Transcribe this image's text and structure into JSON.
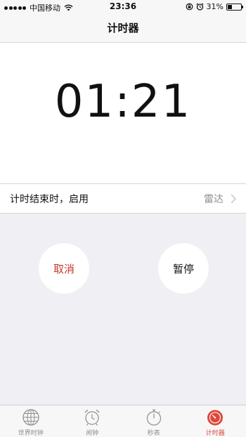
{
  "status_bar": {
    "carrier": "中国移动",
    "time": "23:36",
    "battery_text": "31%",
    "battery_level": 0.31
  },
  "nav": {
    "title": "计时器"
  },
  "timer": {
    "minutes": "01",
    "separator": ":",
    "seconds": "21"
  },
  "setting": {
    "label": "计时结束时，启用",
    "value": "雷达"
  },
  "controls": {
    "cancel_label": "取消",
    "pause_label": "暂停"
  },
  "tabs": [
    {
      "label": "世界时钟",
      "icon": "globe-icon"
    },
    {
      "label": "闹钟",
      "icon": "alarm-clock-icon"
    },
    {
      "label": "秒表",
      "icon": "stopwatch-icon"
    },
    {
      "label": "计时器",
      "icon": "timer-icon",
      "active": true
    }
  ],
  "colors": {
    "accent": "#e0473c",
    "cancel": "#c0392b",
    "control_bg": "#efeff4",
    "secondary_text": "#8e8e93"
  }
}
